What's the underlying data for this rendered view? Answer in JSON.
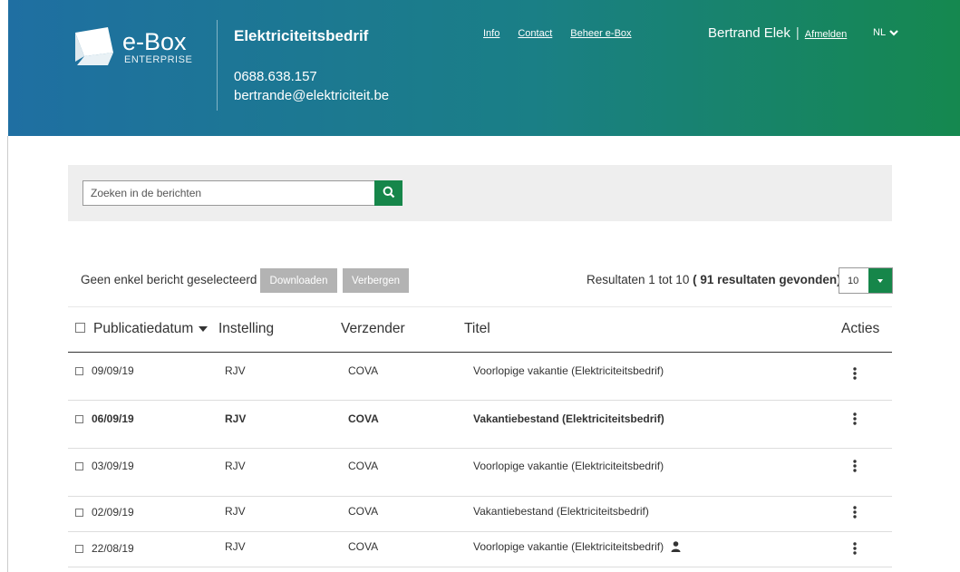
{
  "header": {
    "logo_text": "e-Box",
    "logo_sub": "ENTERPRISE",
    "org_name": "Elektriciteitsbedrif",
    "org_phone": "0688.638.157",
    "org_email": "bertrande@elektriciteit.be",
    "links": [
      "Info",
      "Contact",
      "Beheer e-Box"
    ],
    "user_name": "Bertrand Elek",
    "separator": "|",
    "logout": "Afmelden",
    "language": "NL"
  },
  "search": {
    "placeholder": "Zoeken in de berichten",
    "icon": "search-icon"
  },
  "actions": {
    "selection_text": "Geen enkel bericht geselecteerd",
    "download_label": "Downloaden",
    "hide_label": "Verbergen"
  },
  "results": {
    "prefix": "Resultaten 1 tot 10",
    "count": "( 91 resultaten gevonden)",
    "page_size": "10"
  },
  "table": {
    "columns": [
      "Publicatiedatum",
      "Instelling",
      "Verzender",
      "Titel",
      "Acties"
    ],
    "rows": [
      {
        "date": "09/09/19",
        "institution": "RJV",
        "sender": "COVA",
        "title": "Voorlopige vakantie (Elektriciteitsbedrif)",
        "unread": false,
        "personal": false
      },
      {
        "date": "06/09/19",
        "institution": "RJV",
        "sender": "COVA",
        "title": "Vakantiebestand (Elektriciteitsbedrif)",
        "unread": true,
        "personal": false
      },
      {
        "date": "03/09/19",
        "institution": "RJV",
        "sender": "COVA",
        "title": "Voorlopige vakantie (Elektriciteitsbedrif)",
        "unread": false,
        "personal": false
      },
      {
        "date": "02/09/19",
        "institution": "RJV",
        "sender": "COVA",
        "title": "Vakantiebestand (Elektriciteitsbedrif)",
        "unread": false,
        "personal": false
      },
      {
        "date": "22/08/19",
        "institution": "RJV",
        "sender": "COVA",
        "title": "Voorlopige vakantie (Elektriciteitsbedrif)",
        "unread": false,
        "personal": true
      }
    ]
  },
  "colors": {
    "accent_green": "#16864a",
    "header_blue": "#1f6fa2",
    "button_gray": "#b3b3b3"
  }
}
